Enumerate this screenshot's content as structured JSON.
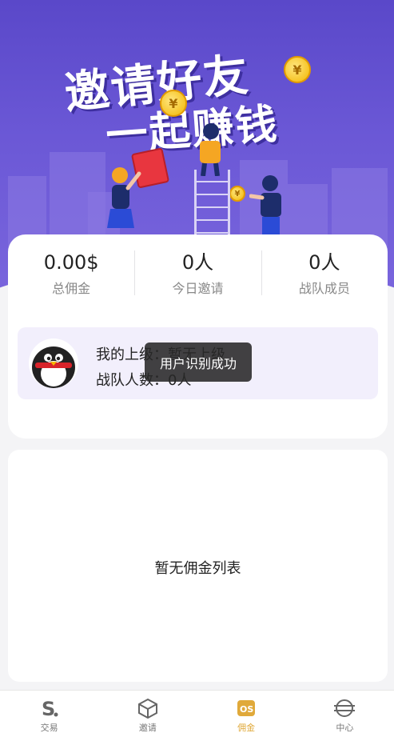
{
  "banner": {
    "title_line1": "邀请好友",
    "title_line2": "一起赚钱",
    "coin_symbol": "¥"
  },
  "stats": [
    {
      "value": "0.00$",
      "label": "总佣金"
    },
    {
      "value": "0人",
      "label": "今日邀请"
    },
    {
      "value": "0人",
      "label": "战队成员"
    }
  ],
  "team": {
    "superior_text": "我的上级：暂无上级",
    "members_text": "战队人数：0人"
  },
  "toast": "用户识别成功",
  "commission_list": {
    "empty_text": "暂无佣金列表"
  },
  "tabbar": {
    "items": [
      {
        "label": "交易",
        "icon": "s-logo-icon"
      },
      {
        "label": "邀请",
        "icon": "cube-icon"
      },
      {
        "label": "佣金",
        "icon": "commission-icon"
      },
      {
        "label": "中心",
        "icon": "center-icon"
      }
    ],
    "active_index": 2
  },
  "colors": {
    "banner_purple": "#5a48c9",
    "active_tab": "#e0a93a",
    "team_box_bg": "#f2effc"
  }
}
